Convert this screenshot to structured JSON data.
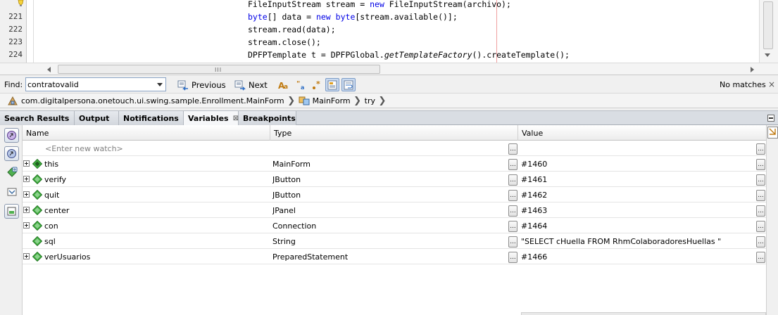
{
  "editor": {
    "lines": [
      {
        "num": "",
        "segments": [
          {
            "t": "FileInputStream stream = "
          },
          {
            "t": "new",
            "kw": true
          },
          {
            "t": " FileInputStream(archivo);"
          }
        ]
      },
      {
        "num": "221",
        "segments": [
          {
            "t": "byte",
            "kw": true
          },
          {
            "t": "[] data = "
          },
          {
            "t": "new",
            "kw": true
          },
          {
            "t": " "
          },
          {
            "t": "byte",
            "kw": true
          },
          {
            "t": "[stream.available()];"
          }
        ]
      },
      {
        "num": "222",
        "segments": [
          {
            "t": "stream.read(data);"
          }
        ]
      },
      {
        "num": "223",
        "segments": [
          {
            "t": "stream.close();"
          }
        ]
      },
      {
        "num": "224",
        "segments": [
          {
            "t": "DPFPTemplate t = DPFPGlobal."
          },
          {
            "t": "getTemplateFactory",
            "it": true
          },
          {
            "t": "().createTemplate();"
          }
        ]
      }
    ],
    "hscroll_grip": "III"
  },
  "findbar": {
    "label": "Find:",
    "value": "contratovalid",
    "previous_label": "Previous",
    "next_label": "Next",
    "status": "No matches"
  },
  "breadcrumb": {
    "items": [
      "com.digitalpersona.onetouch.ui.swing.sample.Enrollment.MainForm",
      "MainForm",
      "try"
    ]
  },
  "tabs": [
    {
      "label": "Search Results",
      "active": false
    },
    {
      "label": "Output",
      "active": false
    },
    {
      "label": "Notifications",
      "active": false
    },
    {
      "label": "Variables",
      "active": true
    },
    {
      "label": "Breakpoints",
      "active": false
    }
  ],
  "variables": {
    "columns": [
      "Name",
      "Type",
      "Value"
    ],
    "new_watch_placeholder": "<Enter new watch>",
    "ellipsis": "...",
    "rows": [
      {
        "name": "this",
        "type": "MainForm",
        "value": "#1460",
        "expandable": true,
        "icon": "field-this-icon"
      },
      {
        "name": "verify",
        "type": "JButton",
        "value": "#1461",
        "expandable": true,
        "icon": "local-variable-icon"
      },
      {
        "name": "quit",
        "type": "JButton",
        "value": "#1462",
        "expandable": true,
        "icon": "local-variable-icon"
      },
      {
        "name": "center",
        "type": "JPanel",
        "value": "#1463",
        "expandable": true,
        "icon": "local-variable-icon"
      },
      {
        "name": "con",
        "type": "Connection",
        "value": "#1464",
        "expandable": true,
        "icon": "local-variable-icon"
      },
      {
        "name": "sql",
        "type": "String",
        "value": "\"SELECT cHuella FROM RhmColaboradoresHuellas \"",
        "expandable": false,
        "icon": "local-variable-icon"
      },
      {
        "name": "verUsuarios",
        "type": "PreparedStatement",
        "value": "#1466",
        "expandable": true,
        "icon": "local-variable-icon"
      }
    ]
  },
  "colors": {
    "keyword": "#0000e6",
    "variable_icon": "#3fae3f",
    "tab_active": "#f6f7f9"
  }
}
